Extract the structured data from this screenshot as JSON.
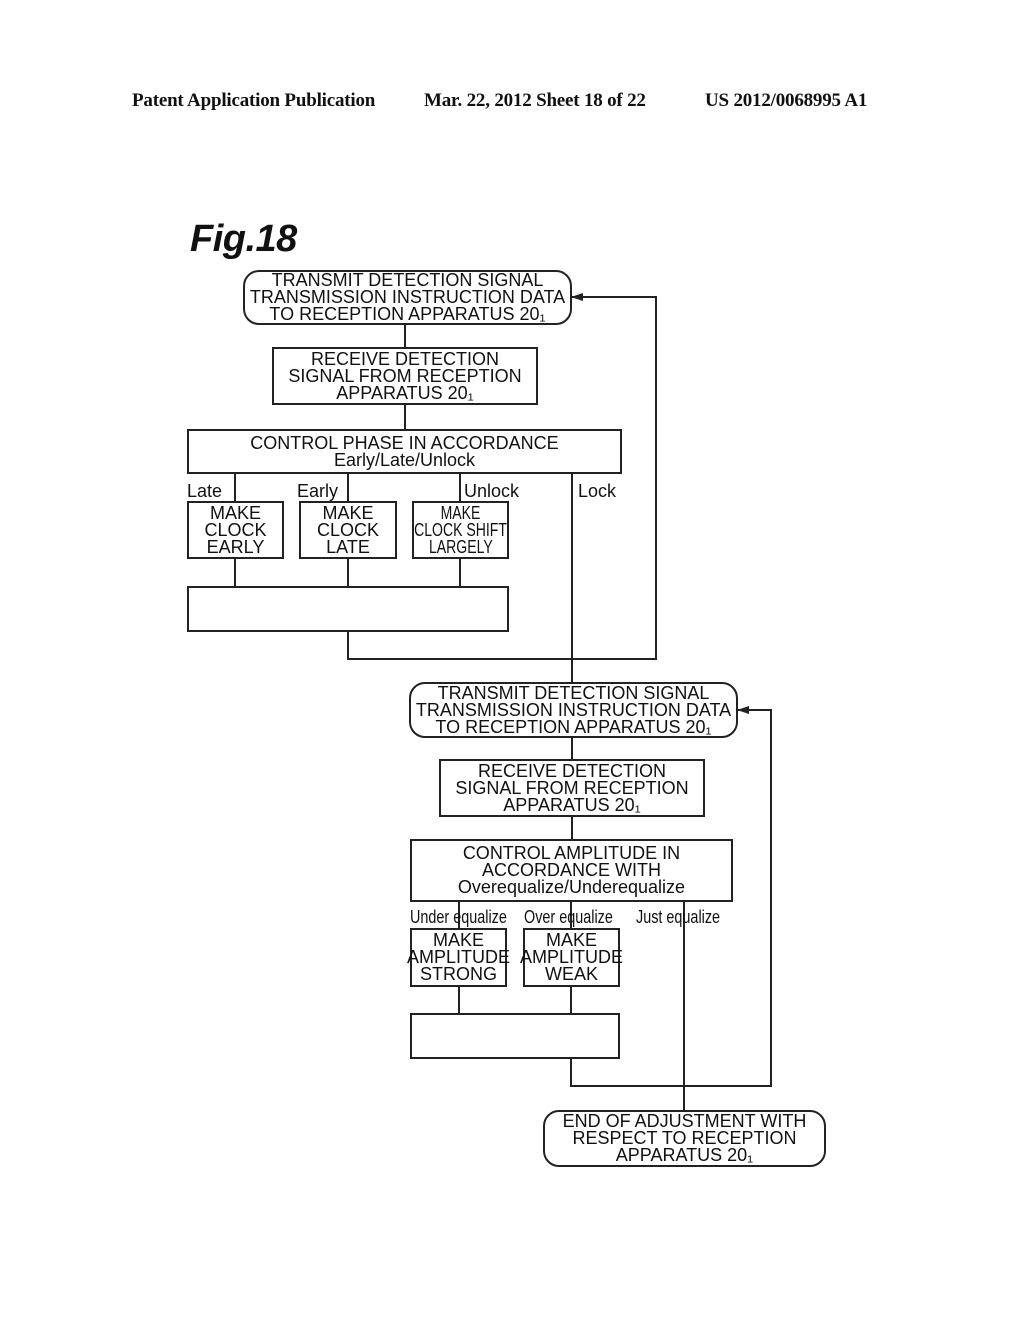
{
  "header": {
    "left": "Patent Application Publication",
    "middle": "Mar. 22, 2012  Sheet 18 of 22",
    "right": "US 2012/0068995 A1"
  },
  "figure_title": "Fig.18",
  "phase_section": {
    "transmit": [
      "TRANSMIT DETECTION SIGNAL",
      "TRANSMISSION INSTRUCTION DATA",
      "TO RECEPTION APPARATUS 20₁"
    ],
    "receive": [
      "RECEIVE DETECTION",
      "SIGNAL FROM RECEPTION",
      "APPARATUS 20₁"
    ],
    "control": [
      "CONTROL PHASE IN ACCORDANCE",
      "Early/Late/Unlock"
    ],
    "branch_labels": {
      "late": "Late",
      "early": "Early",
      "unlock": "Unlock",
      "lock": "Lock"
    },
    "actions": {
      "early": [
        "MAKE",
        "CLOCK",
        "EARLY"
      ],
      "late": [
        "MAKE",
        "CLOCK",
        "LATE"
      ],
      "shift": [
        "MAKE",
        "CLOCK SHIFT",
        "LARGELY"
      ]
    }
  },
  "amplitude_section": {
    "transmit": [
      "TRANSMIT DETECTION SIGNAL",
      "TRANSMISSION INSTRUCTION DATA",
      "TO RECEPTION APPARATUS 20₁"
    ],
    "receive": [
      "RECEIVE DETECTION",
      "SIGNAL FROM RECEPTION",
      "APPARATUS 20₁"
    ],
    "control": [
      "CONTROL AMPLITUDE IN",
      "ACCORDANCE WITH",
      "Overequalize/Underequalize"
    ],
    "branch_labels": {
      "under": "Under equalize",
      "over": "Over equalize",
      "just": "Just equalize"
    },
    "actions": {
      "strong": [
        "MAKE",
        "AMPLITUDE",
        "STRONG"
      ],
      "weak": [
        "MAKE",
        "AMPLITUDE",
        "WEAK"
      ]
    }
  },
  "end_step": [
    "END OF ADJUSTMENT WITH",
    "RESPECT TO RECEPTION",
    "APPARATUS 20₁"
  ]
}
